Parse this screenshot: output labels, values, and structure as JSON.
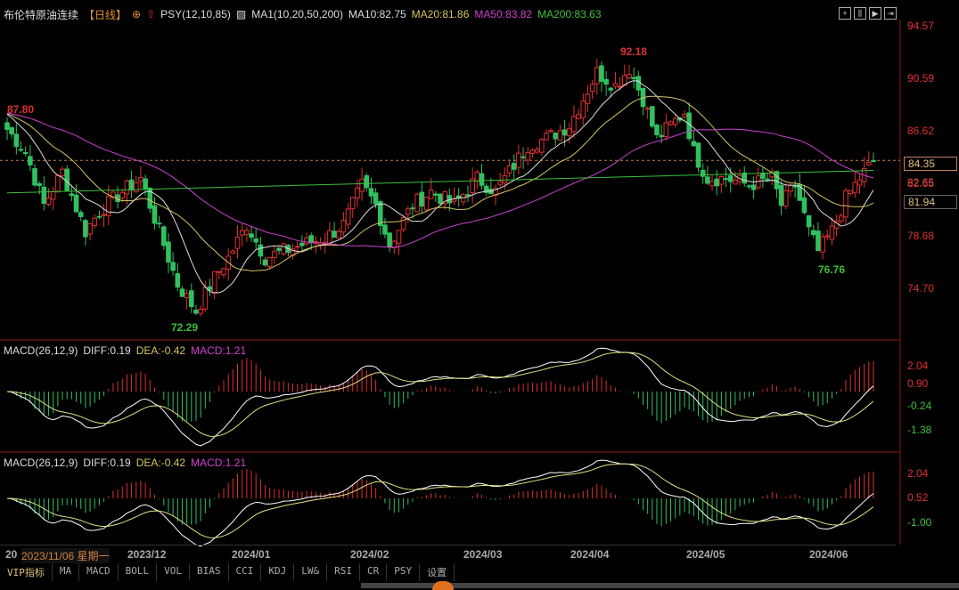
{
  "header": {
    "instrument": "布伦特原油连续",
    "period": "【日线】",
    "psy": "PSY(12,10,85)",
    "ma_label": "MA1(10,20,50,200)",
    "ma10": "MA10:82.75",
    "ma20": "MA20:81.86",
    "ma50": "MA50:83.82",
    "ma200": "MA200:83.63"
  },
  "price_axis": [
    "94.57",
    "90.59",
    "86.62",
    "82.65",
    "78.68",
    "74.70"
  ],
  "price_tags": {
    "last": "84.35",
    "ma_a": "82.65",
    "ma_b": "81.94"
  },
  "annotations": {
    "high1": "87.80",
    "high2": "92.18",
    "low1": "72.29",
    "low2": "76.76"
  },
  "macd1": {
    "label": "MACD(26,12,9)",
    "diff": "DIFF:0.19",
    "dea": "DEA:-0.42",
    "macd": "MACD:1.21",
    "axis": [
      "2.04",
      "0.90",
      "-0.24",
      "-1.38"
    ]
  },
  "macd2": {
    "label": "MACD(26,12,9)",
    "diff": "DIFF:0.19",
    "dea": "DEA:-0.42",
    "macd": "MACD:1.21",
    "axis": [
      "2.04",
      "0.52",
      "-1.00"
    ]
  },
  "xaxis": {
    "prefix": "20",
    "cursor_date": "2023/11/06 星期一",
    "months": [
      "2023/12",
      "2024/01",
      "2024/02",
      "2024/03",
      "2024/04",
      "2024/05",
      "2024/06"
    ]
  },
  "tabs": [
    "VIP指标",
    "MA",
    "MACD",
    "BOLL",
    "VOL",
    "BIAS",
    "CCI",
    "KDJ",
    "LW&",
    "RSI",
    "CR",
    "PSY",
    "设置"
  ],
  "colors": {
    "up": "#e03030",
    "down": "#30c060",
    "ma10": "#dddddd",
    "ma20": "#d4c460",
    "ma50": "#d040d0",
    "ma200": "#3cc03c"
  },
  "chart_data": {
    "type": "candlestick",
    "price_range": [
      74.7,
      94.57
    ],
    "close_keypoints": [
      [
        0,
        86.7
      ],
      [
        4,
        85
      ],
      [
        8,
        81
      ],
      [
        12,
        83.5
      ],
      [
        17,
        79
      ],
      [
        20,
        80.5
      ],
      [
        25,
        82
      ],
      [
        29,
        83
      ],
      [
        33,
        79
      ],
      [
        37,
        75
      ],
      [
        41,
        73
      ],
      [
        45,
        75.5
      ],
      [
        48,
        77
      ],
      [
        52,
        79.5
      ],
      [
        56,
        77
      ],
      [
        60,
        77.5
      ],
      [
        64,
        78
      ],
      [
        69,
        78.5
      ],
      [
        73,
        79.5
      ],
      [
        77,
        82.5
      ],
      [
        80,
        81
      ],
      [
        83,
        78
      ],
      [
        88,
        81
      ],
      [
        92,
        82
      ],
      [
        97,
        81
      ],
      [
        102,
        83
      ],
      [
        106,
        82
      ],
      [
        110,
        84
      ],
      [
        113,
        85.5
      ],
      [
        117,
        86
      ],
      [
        122,
        87
      ],
      [
        125,
        89
      ],
      [
        128,
        91
      ],
      [
        132,
        90
      ],
      [
        135,
        91.3
      ],
      [
        138,
        89
      ],
      [
        141,
        86
      ],
      [
        144,
        87
      ],
      [
        147,
        88
      ],
      [
        149,
        85
      ],
      [
        152,
        83
      ],
      [
        156,
        83
      ],
      [
        161,
        82.5
      ],
      [
        166,
        83
      ],
      [
        168,
        81
      ],
      [
        171,
        82.5
      ],
      [
        174,
        79
      ],
      [
        176,
        77.5
      ],
      [
        179,
        79
      ],
      [
        182,
        81.5
      ],
      [
        185,
        83
      ],
      [
        188,
        84.3
      ]
    ]
  }
}
